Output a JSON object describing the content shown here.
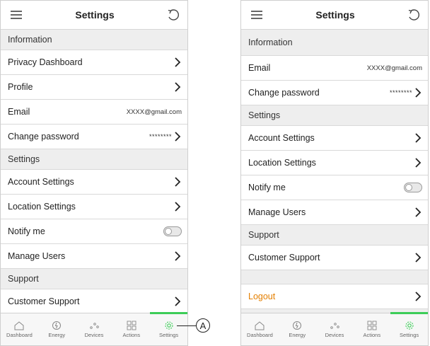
{
  "left": {
    "title": "Settings",
    "sections": {
      "information": "Information",
      "settings": "Settings",
      "support": "Support"
    },
    "rows": {
      "privacy": "Privacy Dashboard",
      "profile": "Profile",
      "email_label": "Email",
      "email_value": "XXXX@gmail.com",
      "password_label": "Change password",
      "password_value": "********",
      "account": "Account Settings",
      "location": "Location Settings",
      "notify": "Notify me",
      "users": "Manage Users",
      "customer_support": "Customer Support"
    }
  },
  "right": {
    "title": "Settings",
    "sections": {
      "information": "Information",
      "settings": "Settings",
      "support": "Support"
    },
    "rows": {
      "email_label": "Email",
      "email_value": "XXXX@gmail.com",
      "password_label": "Change password",
      "password_value": "********",
      "account": "Account Settings",
      "location": "Location Settings",
      "notify": "Notify me",
      "users": "Manage Users",
      "customer_support": "Customer Support",
      "logout": "Logout"
    }
  },
  "nav": [
    "Dashboard",
    "Energy",
    "Devices",
    "Actions",
    "Settings"
  ],
  "callout": "A",
  "colors": {
    "accent_green": "#3dcd58",
    "logout_orange": "#e47f00"
  },
  "notify_enabled": false
}
